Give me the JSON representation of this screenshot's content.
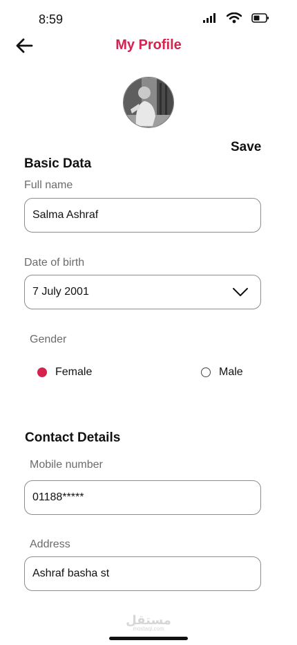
{
  "status_bar": {
    "time": "8:59",
    "icons": [
      "signal-icon",
      "wifi-icon",
      "battery-icon"
    ]
  },
  "header": {
    "back_icon": "arrow-left-icon",
    "title": "My Profile"
  },
  "profile": {
    "save_label": "Save"
  },
  "basic_data": {
    "heading": "Basic Data",
    "full_name": {
      "label": "Full name",
      "value": "Salma Ashraf"
    },
    "date_of_birth": {
      "label": "Date of birth",
      "value": "7 July 2001"
    },
    "gender": {
      "label": "Gender",
      "options": [
        {
          "label": "Female",
          "selected": true
        },
        {
          "label": "Male",
          "selected": false
        }
      ]
    }
  },
  "contact_details": {
    "heading": "Contact Details",
    "mobile": {
      "label": "Mobile number",
      "value": "01188*****"
    },
    "address": {
      "label": "Address",
      "value": "Ashraf basha st"
    }
  },
  "watermark": {
    "text": "مستقل",
    "subtext": "mostaql.com"
  },
  "colors": {
    "accent": "#d4234e",
    "text": "#111111",
    "muted": "#6b6b6b",
    "border": "#8b8b8b"
  }
}
